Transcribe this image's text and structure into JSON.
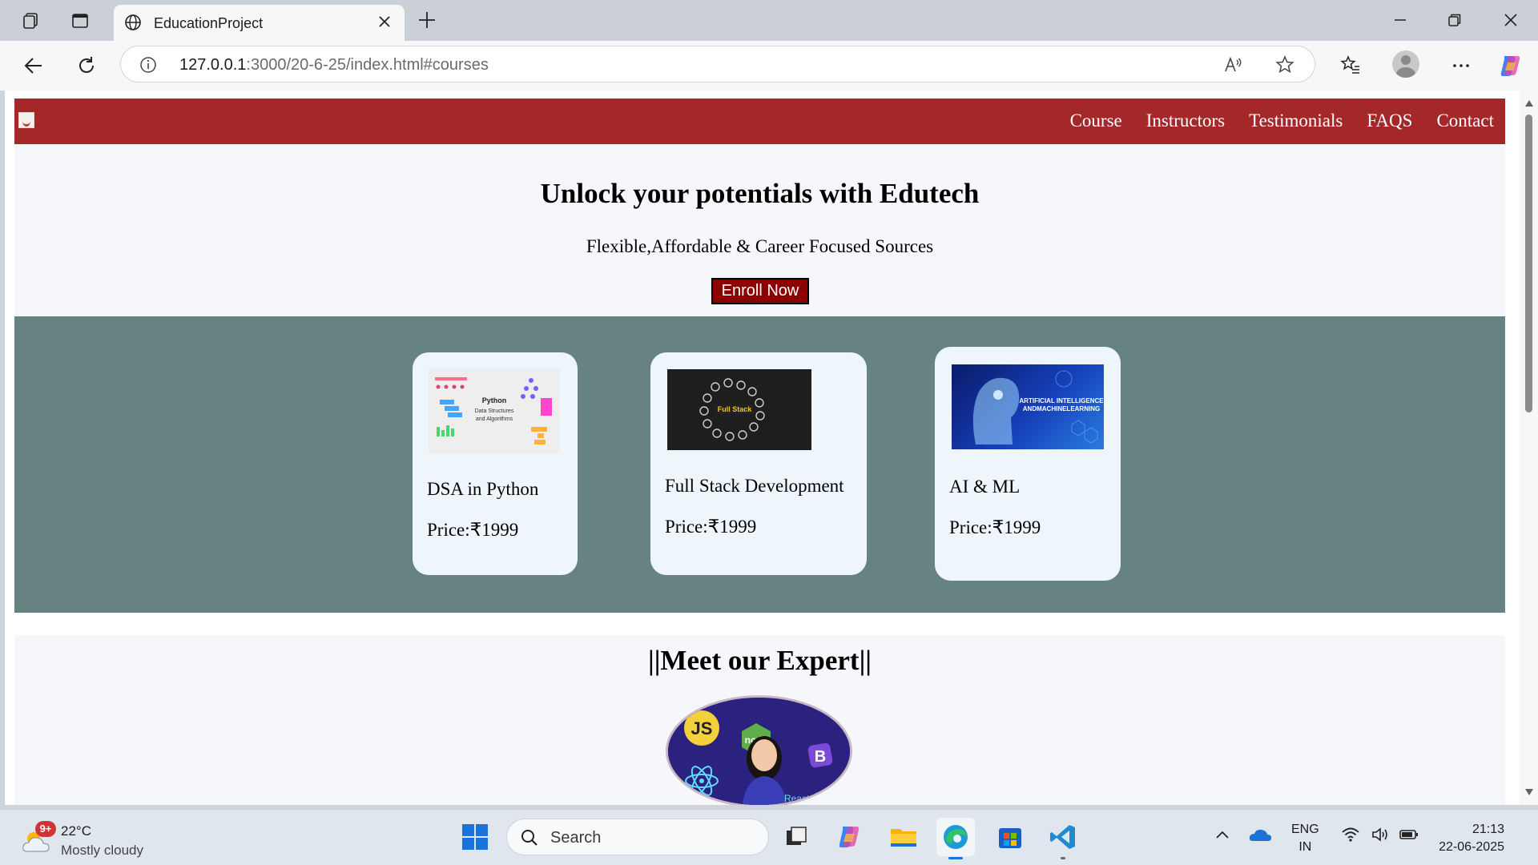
{
  "browser": {
    "tab_title": "EducationProject",
    "url_host": "127.0.0.1",
    "url_rest": ":3000/20-6-25/index.html#courses"
  },
  "site": {
    "nav_links": [
      "Course",
      "Instructors",
      "Testimonials",
      "FAQS",
      "Contact"
    ],
    "brand_color": "#a4282a",
    "hero": {
      "title": "Unlock your potentials with Edutech",
      "subtitle": "Flexible,Affordable & Career Focused Sources",
      "cta": "Enroll Now"
    },
    "courses": [
      {
        "name": "DSA in Python",
        "price": "Price:₹1999",
        "thumb_text": [
          "Python",
          "Data Structures",
          "and Algorithms"
        ]
      },
      {
        "name": "Full Stack Development",
        "price": "Price:₹1999",
        "thumb_text": [
          "Full Stack"
        ]
      },
      {
        "name": "AI & ML",
        "price": "Price:₹1999",
        "thumb_text": [
          "ARTIFICIAL INTELLIGENCE",
          "ANDMACHINELEARNING"
        ]
      }
    ],
    "experts_heading": "||Meet our Expert||",
    "expert_badges": [
      "JS",
      "node",
      "B",
      "React"
    ],
    "courses_bg": "#668281"
  },
  "taskbar": {
    "weather_temp": "22°C",
    "weather_cond": "Mostly cloudy",
    "weather_badge": "9+",
    "search_label": "Search",
    "lang_line1": "ENG",
    "lang_line2": "IN",
    "time": "21:13",
    "date": "22-06-2025"
  }
}
